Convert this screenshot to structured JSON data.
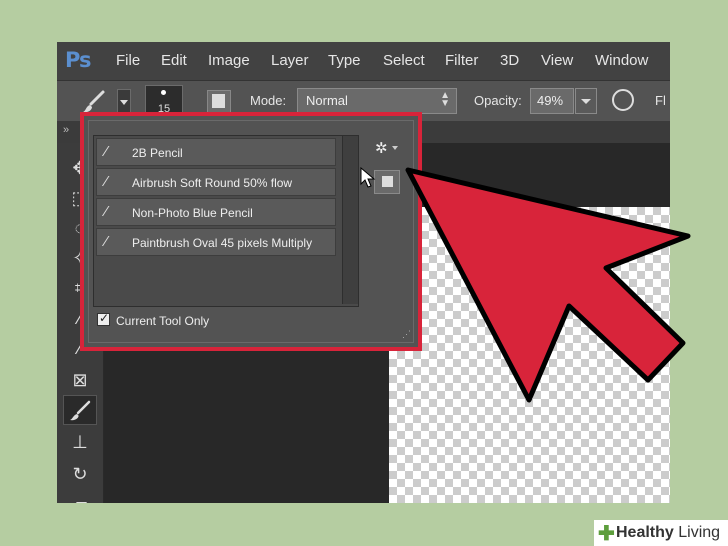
{
  "app": {
    "logo": "Ps"
  },
  "menu": [
    "File",
    "Edit",
    "Image",
    "Layer",
    "Type",
    "Select",
    "Filter",
    "3D",
    "View",
    "Window"
  ],
  "options_bar": {
    "brush_size": "15",
    "mode_label": "Mode:",
    "mode_value": "Normal",
    "opacity_label": "Opacity:",
    "opacity_value": "49%",
    "flow_label_partial": "Fl"
  },
  "preset_panel": {
    "presets": [
      {
        "label": "2B Pencil"
      },
      {
        "label": "Airbrush Soft Round 50% flow"
      },
      {
        "label": "Non-Photo Blue Pencil"
      },
      {
        "label": "Paintbrush Oval 45 pixels Multiply"
      }
    ],
    "current_tool_only_label": "Current Tool Only",
    "current_tool_only_checked": true
  },
  "colors": {
    "highlight": "#d8243a",
    "arrow": "#d8243a",
    "background": "#b5cda1"
  },
  "footer": {
    "brand_bold": "Healthy",
    "brand_light": "Living"
  }
}
